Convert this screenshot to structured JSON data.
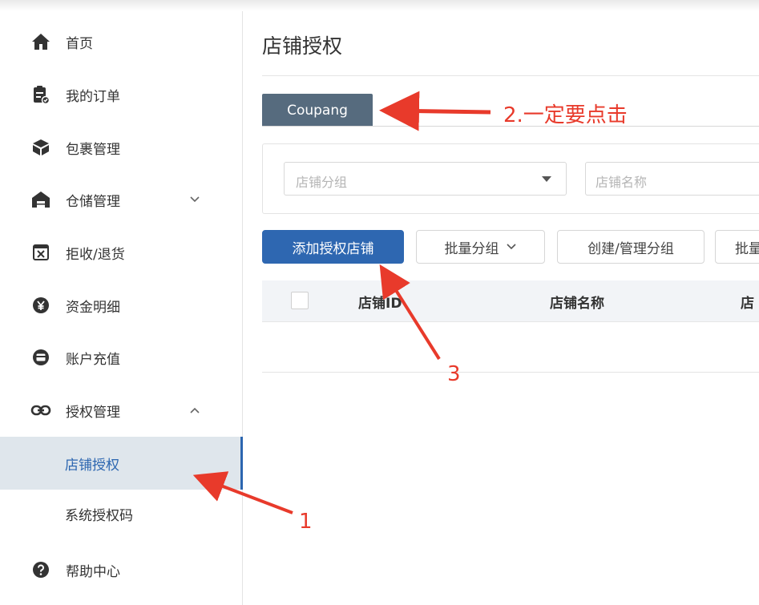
{
  "sidebar": {
    "items": [
      {
        "label": "首页",
        "icon": "home-icon"
      },
      {
        "label": "我的订单",
        "icon": "order-clipboard-icon"
      },
      {
        "label": "包裹管理",
        "icon": "package-cube-icon"
      },
      {
        "label": "仓储管理",
        "icon": "warehouse-icon"
      },
      {
        "label": "拒收/退货",
        "icon": "return-box-icon"
      },
      {
        "label": "资金明细",
        "icon": "yen-coin-icon"
      },
      {
        "label": "账户充值",
        "icon": "wallet-icon"
      },
      {
        "label": "授权管理",
        "icon": "link-icon"
      },
      {
        "label": "店铺授权"
      },
      {
        "label": "系统授权码"
      },
      {
        "label": "帮助中心",
        "icon": "help-circle-icon"
      }
    ],
    "active_item": "店铺授权"
  },
  "main": {
    "page_title": "店铺授权",
    "tabs": [
      {
        "label": "Coupang"
      }
    ],
    "filters": {
      "group_select_placeholder": "店铺分组",
      "name_input_placeholder": "店铺名称"
    },
    "toolbar": {
      "add_button": "添加授权店铺",
      "batch_group_button": "批量分组",
      "manage_group_button": "创建/管理分组",
      "batch_cut_button": "批量"
    },
    "table": {
      "headers": [
        "店铺ID",
        "店铺名称",
        "店"
      ]
    }
  },
  "annotations": {
    "note_1": "1",
    "note_2": "2.一定要点击",
    "note_3": "3",
    "color": "#e83a2b"
  },
  "colors": {
    "accent": "#2e67b1",
    "tab_bg": "#566b7e",
    "active_bg": "#dfe6ec"
  }
}
